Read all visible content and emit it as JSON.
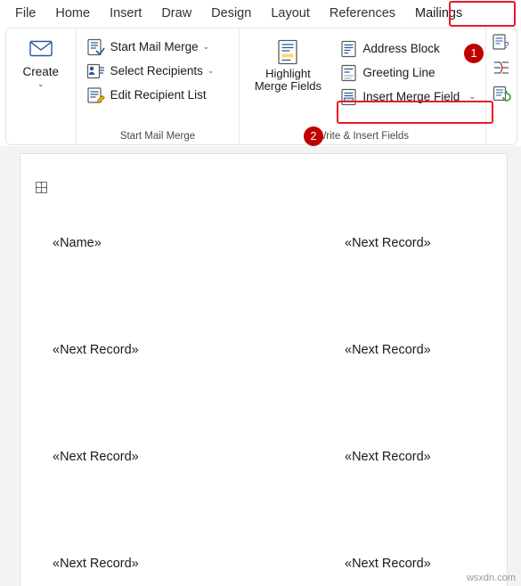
{
  "ribbon": {
    "tabs": [
      {
        "label": "File",
        "active": false
      },
      {
        "label": "Home",
        "active": false
      },
      {
        "label": "Insert",
        "active": false
      },
      {
        "label": "Draw",
        "active": false
      },
      {
        "label": "Design",
        "active": false
      },
      {
        "label": "Layout",
        "active": false
      },
      {
        "label": "References",
        "active": false
      },
      {
        "label": "Mailings",
        "active": true
      }
    ],
    "groups": {
      "create": {
        "label": "",
        "button_label": "Create",
        "chevron": "⌄"
      },
      "start_mail_merge": {
        "label": "Start Mail Merge",
        "items": [
          {
            "label": "Start Mail Merge",
            "chevron": "⌄"
          },
          {
            "label": "Select Recipients",
            "chevron": "⌄"
          },
          {
            "label": "Edit Recipient List",
            "chevron": ""
          }
        ]
      },
      "write_insert": {
        "label": "Write & Insert Fields",
        "highlight_button": {
          "line1": "Highlight",
          "line2": "Merge Fields"
        },
        "items": [
          {
            "label": "Address Block",
            "chevron": ""
          },
          {
            "label": "Greeting Line",
            "chevron": ""
          },
          {
            "label": "Insert Merge Field",
            "chevron": "⌄",
            "highlighted": true
          }
        ]
      }
    },
    "callouts": [
      {
        "number": "1"
      },
      {
        "number": "2"
      }
    ]
  },
  "document": {
    "fields": [
      {
        "text": "«Name»",
        "col": "left",
        "row": 1
      },
      {
        "text": "«Next Record»",
        "col": "right",
        "row": 1
      },
      {
        "text": "«Next Record»",
        "col": "left",
        "row": 2
      },
      {
        "text": "«Next Record»",
        "col": "right",
        "row": 2
      },
      {
        "text": "«Next Record»",
        "col": "left",
        "row": 3
      },
      {
        "text": "«Next Record»",
        "col": "right",
        "row": 3
      },
      {
        "text": "«Next Record»",
        "col": "left",
        "row": 4
      },
      {
        "text": "«Next Record»",
        "col": "right",
        "row": 4
      }
    ],
    "watermark": "wsxdn.com"
  },
  "colors": {
    "accent_red": "#e8192c",
    "badge_red": "#c00000",
    "icon_blue": "#2b579a",
    "ribbon_border": "#e4e4e4"
  }
}
